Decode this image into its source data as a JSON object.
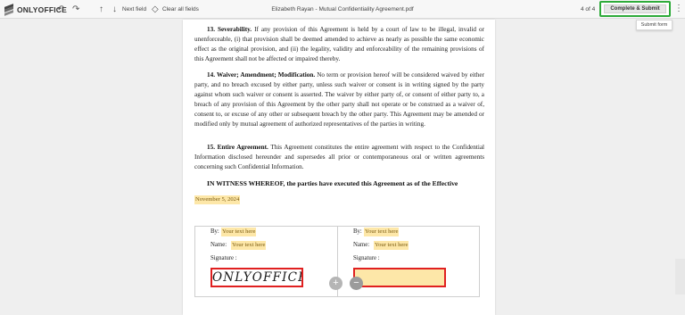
{
  "toolbar": {
    "logo_text": "ONLYOFFICE",
    "undo_icon": "↶",
    "redo_icon": "↷",
    "prev_icon": "↑",
    "next_icon": "↓",
    "next_field_label": "Next field",
    "clear_icon": "◇",
    "clear_fields_label": "Clear all fields",
    "doc_title": "Elizabeth Rayan - Mutual Confidentiality Agreement.pdf",
    "page_count": "4 of 4",
    "complete_label": "Complete & Submit",
    "more_icon": "⋮",
    "tooltip": "Submit form"
  },
  "document": {
    "sec13_title": "13. Severability.",
    "sec13_body": " If any provision of this Agreement is held by a court of law to be illegal, invalid or unenforceable, (i) that provision shall be deemed amended to achieve as nearly as possible the same economic effect as the original provision, and (ii) the legality, validity and enforceability of the remaining provisions of this Agreement shall not be affected or impaired thereby.",
    "sec14_title": "14. Waiver; Amendment; Modification.",
    "sec14_body": " No term or provision hereof will be considered waived by either party, and no breach excused by either party, unless such waiver or consent is in writing signed by the party against whom such waiver or consent is asserted. The waiver by either party of, or consent of either party to, a breach of any provision of this Agreement by the other party shall not operate or be construed as a waiver of, consent to, or excuse of any other or subsequent breach by the other party. This Agreement may be amended or modified only by mutual agreement of authorized representatives of the parties in writing.",
    "sec15_title": "15. Entire Agreement.",
    "sec15_body": " This Agreement constitutes the entire agreement with respect to the Confidential Information disclosed hereunder and supersedes all prior or contemporaneous oral or written agreements concerning such Confidential Information.",
    "witness": "IN WITNESS WHEREOF, the parties have executed this Agreement as of the Effective",
    "date_value": "November 5, 2024"
  },
  "signature_table": {
    "left": {
      "by_label": "By:",
      "by_value": "Your text here",
      "name_label": "Name:",
      "name_value": "Your text here",
      "signature_label": "Signature :",
      "signature_value": "ONLYOFFICE"
    },
    "right": {
      "by_label": "By:",
      "by_value": "Your text here",
      "name_label": "Name:",
      "name_value": "Your text here",
      "signature_label": "Signature :",
      "signature_value": ""
    },
    "add_icon": "+",
    "remove_icon": "−"
  },
  "colors": {
    "accent_green": "#2eab3a",
    "field_highlight": "#fde7a8",
    "signature_border": "#e02020"
  }
}
